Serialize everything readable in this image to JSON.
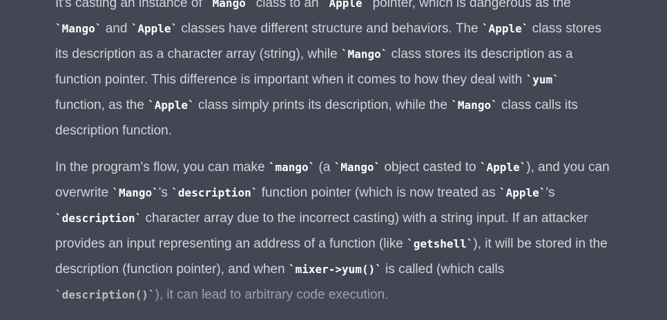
{
  "message": {
    "paragraph1": {
      "line0": {
        "t0": "It's casting an instance of ",
        "c0": "`Mango`",
        "t1": " class to an ",
        "c1": "`Apple`",
        "t2": " pointer, which is dangerous as the"
      },
      "line1": {
        "c0": "`Mango`",
        "t0": " and ",
        "c1": "`Apple`",
        "t1": " classes have different structure and behaviors. The ",
        "c2": "`Apple`",
        "t2": " class stores"
      },
      "line2": {
        "t0": "its description as a character array (string), while ",
        "c0": "`Mango`",
        "t1": " class stores its description as a"
      },
      "line3": {
        "t0": "function pointer. This difference is important when it comes to how they deal with ",
        "c0": "`yum`"
      },
      "line4": {
        "t0": "function, as the ",
        "c0": "`Apple`",
        "t1": " class simply prints its description, while the ",
        "c1": "`Mango`",
        "t2": " class calls its"
      },
      "line5": {
        "t0": "description function."
      }
    },
    "paragraph2": {
      "line0": {
        "t0": "In the program's flow, you can make ",
        "c0": "`mango`",
        "t1": " (a ",
        "c1": "`Mango`",
        "t2": " object casted to ",
        "c2": "`Apple`",
        "t3": "), and you can"
      },
      "line1": {
        "t0": "overwrite ",
        "c0": "`Mango`",
        "t1": "'s ",
        "c1": "`description`",
        "t2": " function pointer (which is now treated as ",
        "c2": "`Apple`",
        "t3": "'s"
      },
      "line2": {
        "c0": "`description`",
        "t0": " character array due to the incorrect casting) with a string input. If an attacker"
      },
      "line3": {
        "t0": "provides an input representing an address of a function (like ",
        "c0": "`getshell`",
        "t1": "), it will be stored in the"
      },
      "line4": {
        "t0": "description (function pointer), and when ",
        "c0": "`mixer->yum()`",
        "t1": " is called (which calls"
      },
      "line5": {
        "c0": "`description()`",
        "t0": "), it can lead to arbitrary code execution."
      }
    }
  }
}
